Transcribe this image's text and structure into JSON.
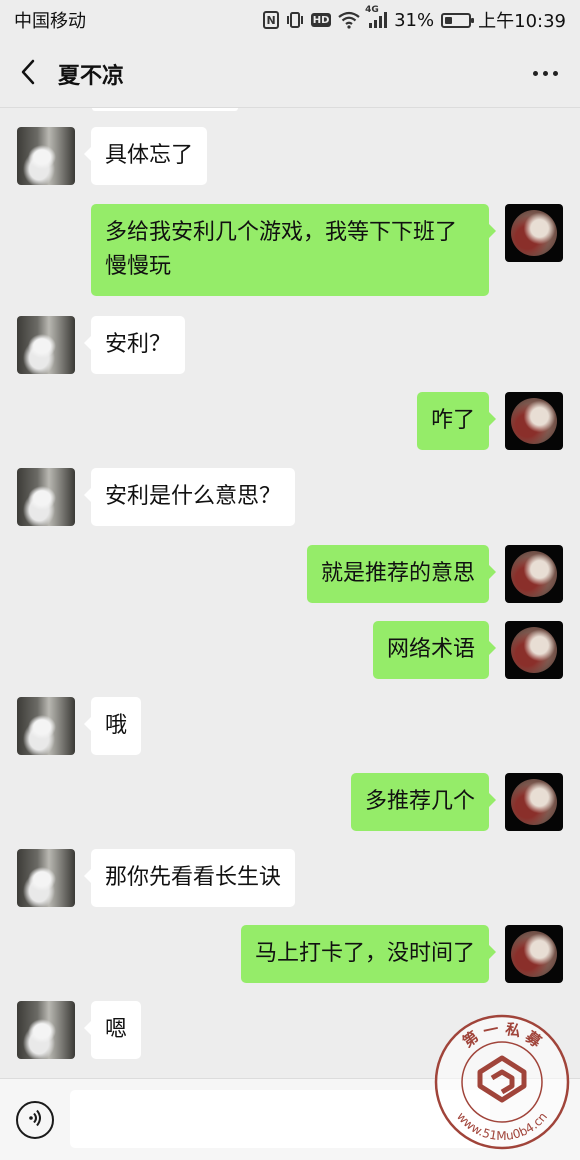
{
  "status_bar": {
    "carrier": "中国移动",
    "network": "4G",
    "battery_percent_text": "31%",
    "battery_level": 0.31,
    "time": "上午10:39",
    "icons": [
      "nfc-icon",
      "vibrate-icon",
      "hd-icon",
      "wifi-icon",
      "signal-icon",
      "battery-icon"
    ]
  },
  "header": {
    "title": "夏不凉",
    "back_icon": "chevron-left-icon",
    "more_icon": "more-dots-icon"
  },
  "messages": [
    {
      "side": "left",
      "text": "具体忘了"
    },
    {
      "side": "right",
      "text": "多给我安利几个游戏，我等下下班了慢慢玩"
    },
    {
      "side": "left",
      "text": "安利？"
    },
    {
      "side": "right",
      "text": "咋了"
    },
    {
      "side": "left",
      "text": "安利是什么意思？"
    },
    {
      "side": "right",
      "text": "就是推荐的意思"
    },
    {
      "side": "right",
      "text": "网络术语"
    },
    {
      "side": "left",
      "text": "哦"
    },
    {
      "side": "right",
      "text": "多推荐几个"
    },
    {
      "side": "left",
      "text": "那你先看看长生诀"
    },
    {
      "side": "right",
      "text": "马上打卡了，没时间了"
    },
    {
      "side": "left",
      "text": "嗯"
    }
  ],
  "input_bar": {
    "voice_icon": "voice-icon",
    "text_value": ""
  },
  "watermark": {
    "top_text": "第 一 私 募",
    "bottom_text": "www.51Mu0b4.cn"
  },
  "colors": {
    "background": "#ededed",
    "outgoing_bubble": "#95ec69",
    "incoming_bubble": "#ffffff",
    "watermark": "#a0443a"
  }
}
